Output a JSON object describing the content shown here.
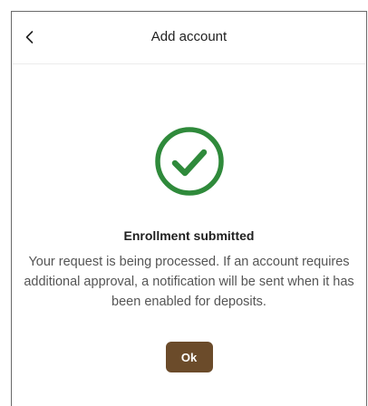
{
  "header": {
    "title": "Add account",
    "back_icon": "chevron-left-icon"
  },
  "status": {
    "icon": "check-circle-icon",
    "icon_color": "#2f8a3b",
    "title": "Enrollment submitted",
    "message": "Your request is being processed. If an account requires additional approval, a notification will be sent when it has been enabled for deposits."
  },
  "actions": {
    "ok_label": "Ok",
    "ok_color": "#6b4b2a"
  }
}
